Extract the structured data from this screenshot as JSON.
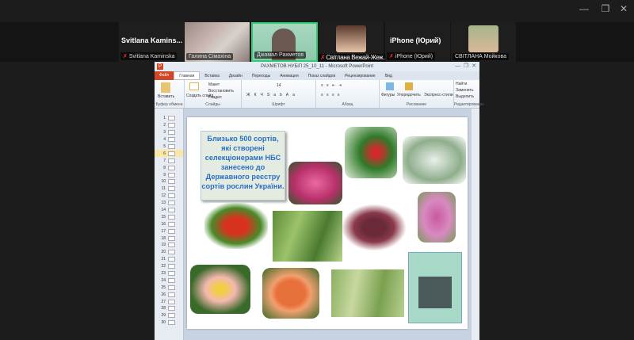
{
  "window_controls": {
    "minimize": "—",
    "restore": "❐",
    "close": "✕"
  },
  "participants": [
    {
      "display": "Svitlana  Kamins...",
      "name": "Svitlana Kaminska",
      "muted": true,
      "video": false
    },
    {
      "name": "Галина Сімахіна",
      "muted": false,
      "video": true
    },
    {
      "name": "Джамал Рахметов",
      "muted": false,
      "video": true,
      "speaking": true
    },
    {
      "name": "Світлана Вежай-Жеж...",
      "muted": true,
      "video": false,
      "avatar": true
    },
    {
      "display": "iPhone (Юрий)",
      "name": "iPhone (Юрий)",
      "muted": true,
      "video": false
    },
    {
      "name": "СВІТЛАНА Мойкова",
      "muted": false,
      "video": false,
      "avatar": true
    }
  ],
  "ppt": {
    "title": "РАХМЕТОВ НУБіП 25_10_11 - Microsoft PowerPoint",
    "tabs": [
      "Файл",
      "Главная",
      "Вставка",
      "Дизайн",
      "Переходы",
      "Анимация",
      "Показ слайдов",
      "Рецензирование",
      "Вид"
    ],
    "active_tab": "Главная",
    "groups": [
      {
        "label": "Буфер обмена",
        "items": [
          "Вставить"
        ]
      },
      {
        "label": "Слайды",
        "items": [
          "Создать слайд",
          "Макет",
          "Восстановить",
          "Раздел"
        ]
      },
      {
        "label": "Шрифт",
        "items": [
          "14"
        ]
      },
      {
        "label": "Абзац",
        "items": []
      },
      {
        "label": "Рисование",
        "items": [
          "Фигуры",
          "Упорядочить",
          "Экспресс-стили"
        ]
      },
      {
        "label": "Редактирование",
        "items": [
          "Найти",
          "Заменить",
          "Выделить"
        ]
      }
    ],
    "slides": [
      "1",
      "2",
      "3",
      "4",
      "5",
      "6",
      "7",
      "8",
      "9",
      "10",
      "11",
      "12",
      "13",
      "14",
      "15",
      "16",
      "17",
      "18",
      "19",
      "20",
      "21",
      "22",
      "23",
      "24",
      "25",
      "26",
      "27",
      "28",
      "29",
      "30"
    ],
    "selected_slide": "6",
    "slide_text": "Близько 500 сортів, які  створені селекціонерами НБС занесено до Державного реєстру сортів рослин України.",
    "accent": "#d24726"
  }
}
